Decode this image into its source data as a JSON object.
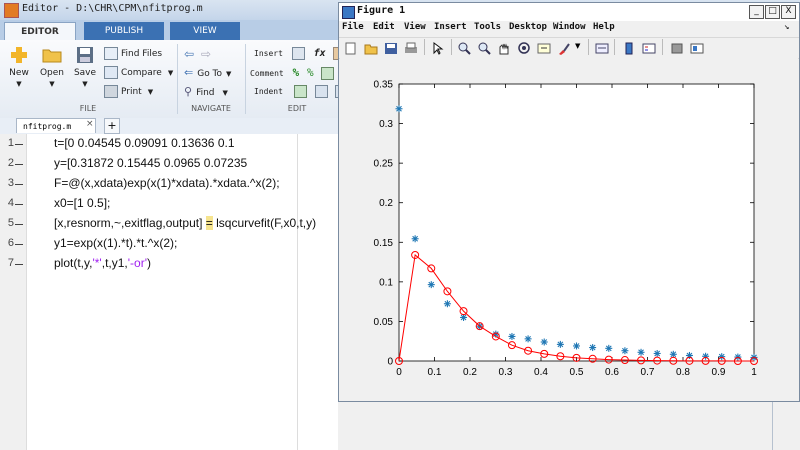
{
  "editor": {
    "title": "Editor - D:\\CHR\\CPM\\nfitprog.m",
    "tabs": [
      "EDITOR",
      "PUBLISH",
      "VIEW"
    ],
    "file_group": {
      "new_label": "New",
      "open_label": "Open",
      "save_label": "Save",
      "find_files_label": "Find Files",
      "compare_label": "Compare",
      "print_label": "Print",
      "group_label": "FILE"
    },
    "navigate_group": {
      "go_to_label": "Go To",
      "find_label": "Find",
      "group_label": "NAVIGATE"
    },
    "edit_group": {
      "insert_label": "Insert",
      "comment_label": "Comment",
      "indent_label": "Indent",
      "fx_label": "fx",
      "group_label": "EDIT"
    },
    "file_tab": "nfitprog.m",
    "file_tab_close": "×",
    "add_tab": "+",
    "lines": [
      {
        "num": "1",
        "pre": "t=[0        0.04545       0.09091       0.13636       0.1",
        "str": "",
        "post": ""
      },
      {
        "num": "2",
        "pre": "y=[0.31872       0.15445       0.0965     0.07235",
        "str": "",
        "post": ""
      },
      {
        "num": "3",
        "pre": "F=@(x,xdata)exp(x(1)*xdata).*xdata.^x(2);",
        "str": "",
        "post": ""
      },
      {
        "num": "4",
        "pre": "x0=[1 0.5];",
        "str": "",
        "post": ""
      },
      {
        "num": "5",
        "pre": "[x,resnorm,~,exitflag,output] ",
        "hl": "=",
        "post": " lsqcurvefit(F,x0,t,y)"
      },
      {
        "num": "6",
        "pre": "y1=exp(x(1).*t).*t.^x(2);",
        "str": "",
        "post": ""
      },
      {
        "num": "7",
        "pre": "plot(t,y,",
        "str": "'*'",
        "mid": ",t,y1,",
        "str2": "'-or'",
        "post": ")"
      }
    ]
  },
  "figure": {
    "title": "Figure 1",
    "window_buttons": {
      "minimize": "_",
      "maximize": "□",
      "close": "X"
    },
    "menus": [
      "File",
      "Edit",
      "View",
      "Insert",
      "Tools",
      "Desktop",
      "Window",
      "Help"
    ],
    "toolbar_icons": [
      "new-figure-icon",
      "open-file-icon",
      "save-figure-icon",
      "print-figure-icon",
      "edit-plot-icon",
      "zoom-in-icon",
      "zoom-out-icon",
      "pan-icon",
      "rotate-3d-icon",
      "data-cursor-icon",
      "brush-icon",
      "link-plot-icon",
      "insert-colorbar-icon",
      "insert-legend-icon",
      "hide-plot-tools-icon",
      "show-plot-tools-icon"
    ],
    "colors": {
      "marker_series": "#1f77b4",
      "fit_series": "#ff0000",
      "axes_bg": "#ffffff"
    }
  },
  "chart_data": {
    "type": "line",
    "title": "",
    "xlabel": "",
    "ylabel": "",
    "xlim": [
      0,
      1
    ],
    "ylim": [
      0,
      0.35
    ],
    "xticks": [
      "0",
      "0.1",
      "0.2",
      "0.3",
      "0.4",
      "0.5",
      "0.6",
      "0.7",
      "0.8",
      "0.9",
      "1"
    ],
    "yticks": [
      "0",
      "0.05",
      "0.1",
      "0.15",
      "0.2",
      "0.25",
      "0.3",
      "0.35"
    ],
    "grid": false,
    "legend": "none",
    "series": [
      {
        "style": "markers-asterisk",
        "color": "#1f77b4",
        "points": [
          [
            0,
            0.31872
          ],
          [
            0.04545,
            0.15445
          ],
          [
            0.09091,
            0.0965
          ],
          [
            0.13636,
            0.07235
          ],
          [
            0.18182,
            0.055
          ],
          [
            0.22727,
            0.044
          ],
          [
            0.27273,
            0.034
          ],
          [
            0.31818,
            0.031
          ],
          [
            0.36364,
            0.028
          ],
          [
            0.40909,
            0.024
          ],
          [
            0.45455,
            0.021
          ],
          [
            0.5,
            0.019
          ],
          [
            0.54545,
            0.017
          ],
          [
            0.59091,
            0.016
          ],
          [
            0.63636,
            0.013
          ],
          [
            0.68182,
            0.011
          ],
          [
            0.72727,
            0.0095
          ],
          [
            0.77273,
            0.0085
          ],
          [
            0.81818,
            0.007
          ],
          [
            0.86364,
            0.006
          ],
          [
            0.90909,
            0.0055
          ],
          [
            0.95455,
            0.005
          ],
          [
            1,
            0.0045
          ]
        ]
      },
      {
        "style": "line-circle",
        "color": "#ff0000",
        "points": [
          [
            0,
            0
          ],
          [
            0.04545,
            0.134
          ],
          [
            0.09091,
            0.117
          ],
          [
            0.13636,
            0.088
          ],
          [
            0.18182,
            0.063
          ],
          [
            0.22727,
            0.044
          ],
          [
            0.27273,
            0.031
          ],
          [
            0.31818,
            0.02
          ],
          [
            0.36364,
            0.013
          ],
          [
            0.40909,
            0.009
          ],
          [
            0.45455,
            0.006
          ],
          [
            0.5,
            0.004
          ],
          [
            0.54545,
            0.0028
          ],
          [
            0.59091,
            0.0018
          ],
          [
            0.63636,
            0.0012
          ],
          [
            0.68182,
            0.0008
          ],
          [
            0.72727,
            0.0005
          ],
          [
            0.77273,
            0.0003
          ],
          [
            0.81818,
            0.0002
          ],
          [
            0.86364,
            0.0001
          ],
          [
            0.90909,
            0.0001
          ],
          [
            0.95455,
            0.0
          ],
          [
            1,
            0.0
          ]
        ]
      }
    ]
  }
}
